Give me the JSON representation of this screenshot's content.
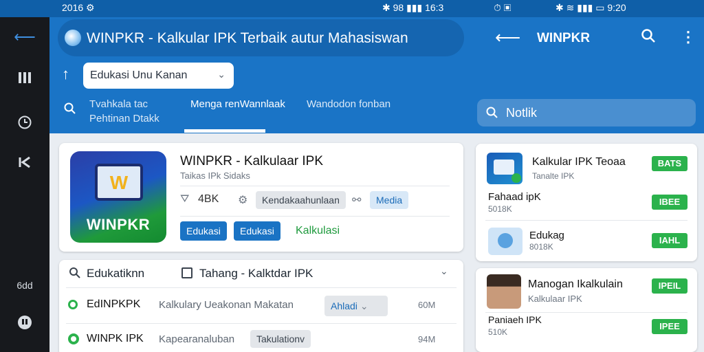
{
  "status": {
    "left": "2016 ⚙",
    "mid": "✱ 98 ▮▮▮ 16:3",
    "icons": "⏱ ▣",
    "right": "✱ ≋ ▮▮▮ ▭ 9:20"
  },
  "rail": {
    "back_icon": "back-arrow-icon",
    "label": "6dd"
  },
  "header": {
    "title": "WINPKR - Kalkular IPK Terbaik autur Mahasiswan",
    "right_title": "WINPKR",
    "dropdown_value": "Edukasi Unu Kanan",
    "tabs": [
      {
        "line1": "Tvahkala tac",
        "line2": "Pehtinan Dtakk"
      },
      {
        "line1": "Menga renWannlaak",
        "line2": ""
      },
      {
        "line1": "Wandodon fonban",
        "line2": ""
      }
    ],
    "search_value": "Notlik"
  },
  "app_card": {
    "icon_label": "WINPKR",
    "icon_letter": "W",
    "title": "WINPKR - Kalkulaar IPK",
    "subtitle": "Taikas IPk Sidaks",
    "rating": "4BK",
    "chip_category": "Kendakaahunlaan",
    "chip_media": "Media",
    "btn1": "Edukasi",
    "btn2": "Edukasi",
    "link": "Kalkulasi"
  },
  "list_card": {
    "header_left": "Edukatiknn",
    "header_right": "Tahang - Kalktdar IPK",
    "rows": [
      {
        "title": "EdINPKPK",
        "desc": "Kalkulary  Ueakonan Makatan",
        "chip": "Ahladi",
        "size": "60M"
      },
      {
        "title": "WINPK IPK",
        "desc": "Kapearanaluban",
        "chip": "Takulationv",
        "size": "94M"
      }
    ]
  },
  "right_card1": {
    "items": [
      {
        "title": "Kalkular IPK Teoaa",
        "sub": "Tanalte IPK",
        "badge": "BATS"
      },
      {
        "title": "Fahaad ipK",
        "sub": "5018K",
        "badge": "IBEE"
      },
      {
        "title": "Edukag",
        "sub": "8018K",
        "badge": "IAHL"
      }
    ]
  },
  "right_card2": {
    "items": [
      {
        "title": "Manogan Ikalkulain",
        "sub": "Kalkulaar IPK",
        "badge": "IPEIL"
      },
      {
        "title": "Paniaeh IPK",
        "sub": "510K",
        "badge": "IPEE"
      }
    ]
  },
  "colors": {
    "header": "#1a74c6",
    "accent_green": "#2bb24c",
    "rail": "#17191d"
  }
}
